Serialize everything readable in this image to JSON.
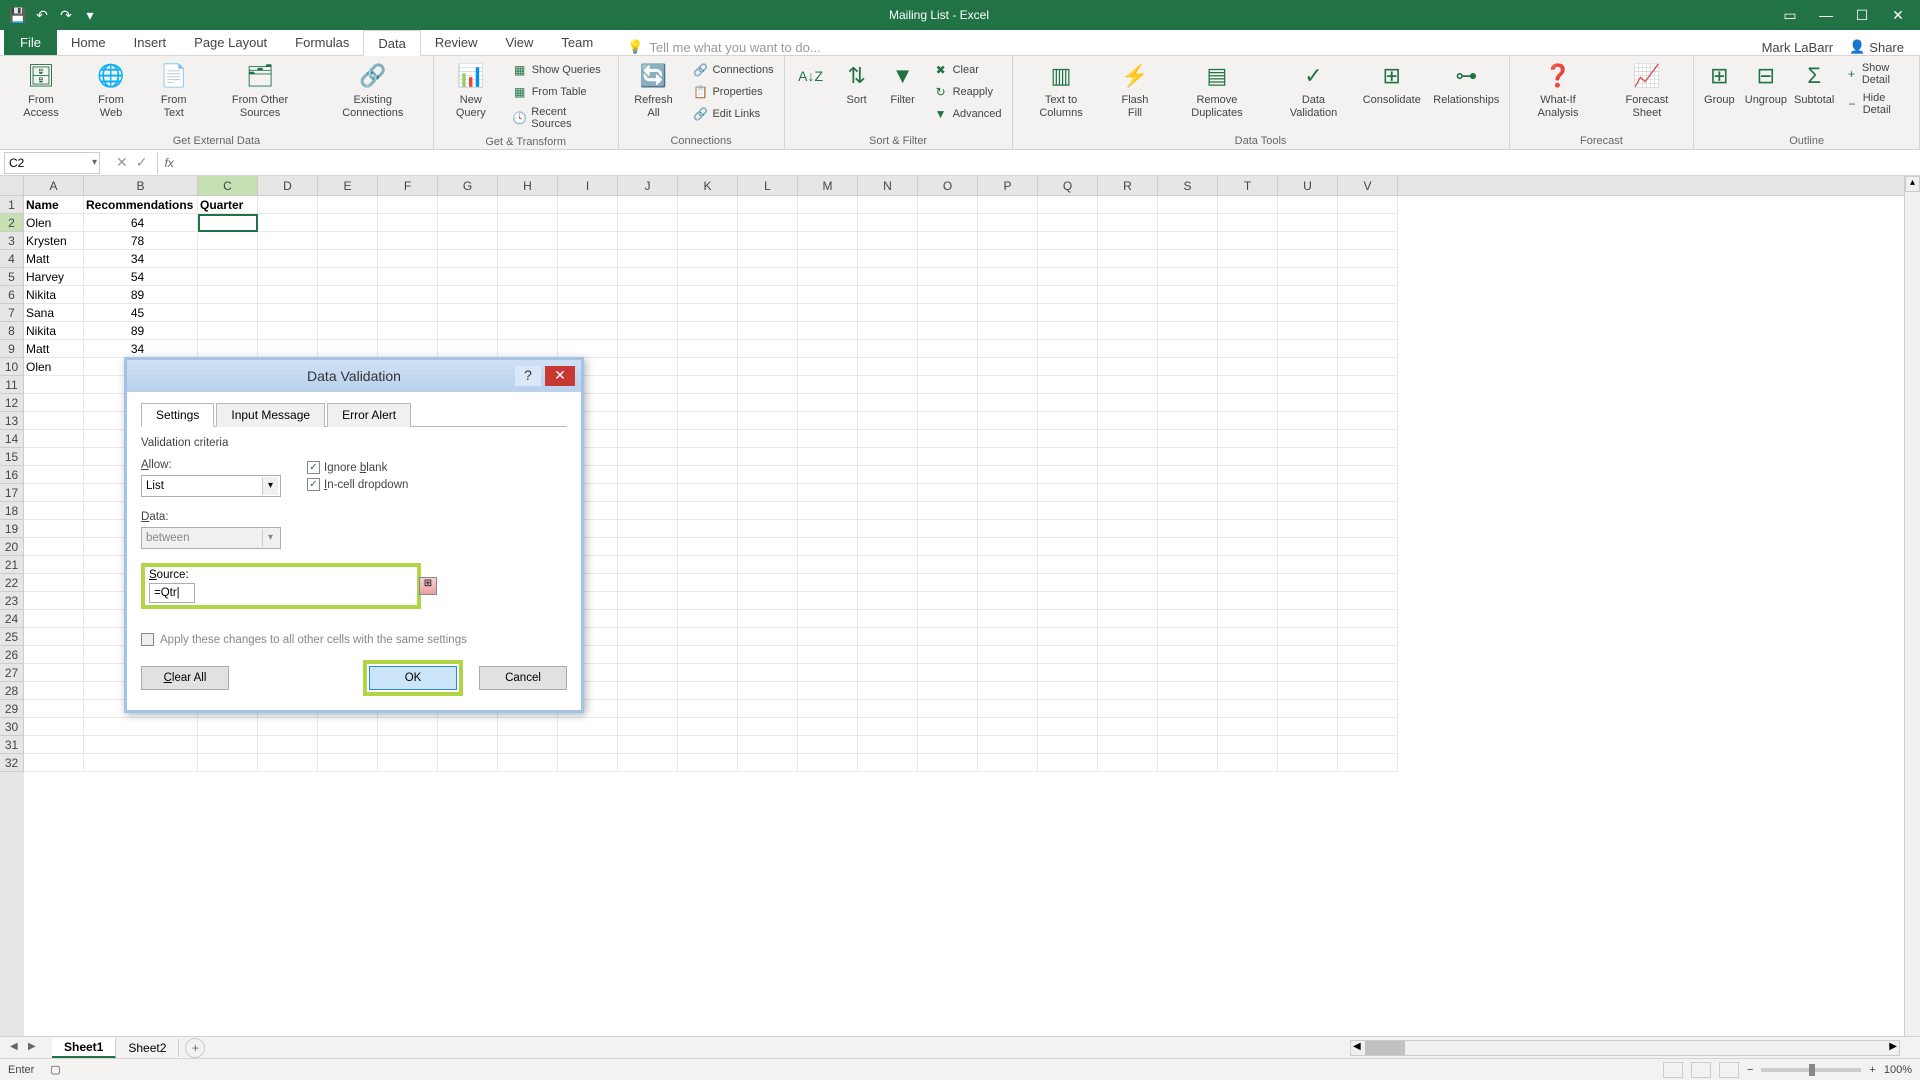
{
  "app": {
    "title": "Mailing List - Excel"
  },
  "user": {
    "name": "Mark LaBarr",
    "share": "Share"
  },
  "tabs": {
    "file": "File",
    "items": [
      "Home",
      "Insert",
      "Page Layout",
      "Formulas",
      "Data",
      "Review",
      "View",
      "Team"
    ],
    "active": 4,
    "tell_me": "Tell me what you want to do..."
  },
  "ribbon": {
    "ext_data": {
      "label": "Get External Data",
      "from_access": "From Access",
      "from_web": "From Web",
      "from_text": "From Text",
      "from_other": "From Other Sources",
      "existing": "Existing Connections"
    },
    "get_transform": {
      "label": "Get & Transform",
      "new_query": "New Query",
      "show_queries": "Show Queries",
      "from_table": "From Table",
      "recent_sources": "Recent Sources"
    },
    "connections": {
      "label": "Connections",
      "refresh_all": "Refresh All",
      "connections": "Connections",
      "properties": "Properties",
      "edit_links": "Edit Links"
    },
    "sort_filter": {
      "label": "Sort & Filter",
      "sort": "Sort",
      "filter": "Filter",
      "clear": "Clear",
      "reapply": "Reapply",
      "advanced": "Advanced"
    },
    "data_tools": {
      "label": "Data Tools",
      "text_to_cols": "Text to Columns",
      "flash_fill": "Flash Fill",
      "remove_dup": "Remove Duplicates",
      "data_val": "Data Validation",
      "consolidate": "Consolidate",
      "relationships": "Relationships"
    },
    "forecast": {
      "label": "Forecast",
      "whatif": "What-If Analysis",
      "forecast_sheet": "Forecast Sheet"
    },
    "outline": {
      "label": "Outline",
      "group": "Group",
      "ungroup": "Ungroup",
      "subtotal": "Subtotal",
      "show_detail": "Show Detail",
      "hide_detail": "Hide Detail"
    }
  },
  "name_box": "C2",
  "formula": "",
  "columns": [
    "A",
    "B",
    "C",
    "D",
    "E",
    "F",
    "G",
    "H",
    "I",
    "J",
    "K",
    "L",
    "M",
    "N",
    "O",
    "P",
    "Q",
    "R",
    "S",
    "T",
    "U",
    "V"
  ],
  "rows": [
    {
      "n": 1,
      "A": "Name",
      "B": "Recommendations",
      "C": "Quarter"
    },
    {
      "n": 2,
      "A": "Olen",
      "B": "64",
      "C": ""
    },
    {
      "n": 3,
      "A": "Krysten",
      "B": "78",
      "C": ""
    },
    {
      "n": 4,
      "A": "Matt",
      "B": "34",
      "C": ""
    },
    {
      "n": 5,
      "A": "Harvey",
      "B": "54",
      "C": ""
    },
    {
      "n": 6,
      "A": "Nikita",
      "B": "89",
      "C": ""
    },
    {
      "n": 7,
      "A": "Sana",
      "B": "45",
      "C": ""
    },
    {
      "n": 8,
      "A": "Nikita",
      "B": "89",
      "C": ""
    },
    {
      "n": 9,
      "A": "Matt",
      "B": "34",
      "C": ""
    },
    {
      "n": 10,
      "A": "Olen",
      "B": "",
      "C": ""
    }
  ],
  "empty_count": 22,
  "sheets": {
    "tabs": [
      "Sheet1",
      "Sheet2"
    ],
    "active": 0
  },
  "status": {
    "mode": "Enter",
    "zoom": "100%"
  },
  "dialog": {
    "title": "Data Validation",
    "tabs": [
      "Settings",
      "Input Message",
      "Error Alert"
    ],
    "active_tab": 0,
    "criteria_label": "Validation criteria",
    "allow_label": "Allow:",
    "allow_value": "List",
    "data_label": "Data:",
    "data_value": "between",
    "ignore_blank": "Ignore blank",
    "in_cell": "In-cell dropdown",
    "source_label": "Source:",
    "source_value": "=Qtr|",
    "apply_changes": "Apply these changes to all other cells with the same settings",
    "clear_all": "Clear All",
    "ok": "OK",
    "cancel": "Cancel"
  }
}
